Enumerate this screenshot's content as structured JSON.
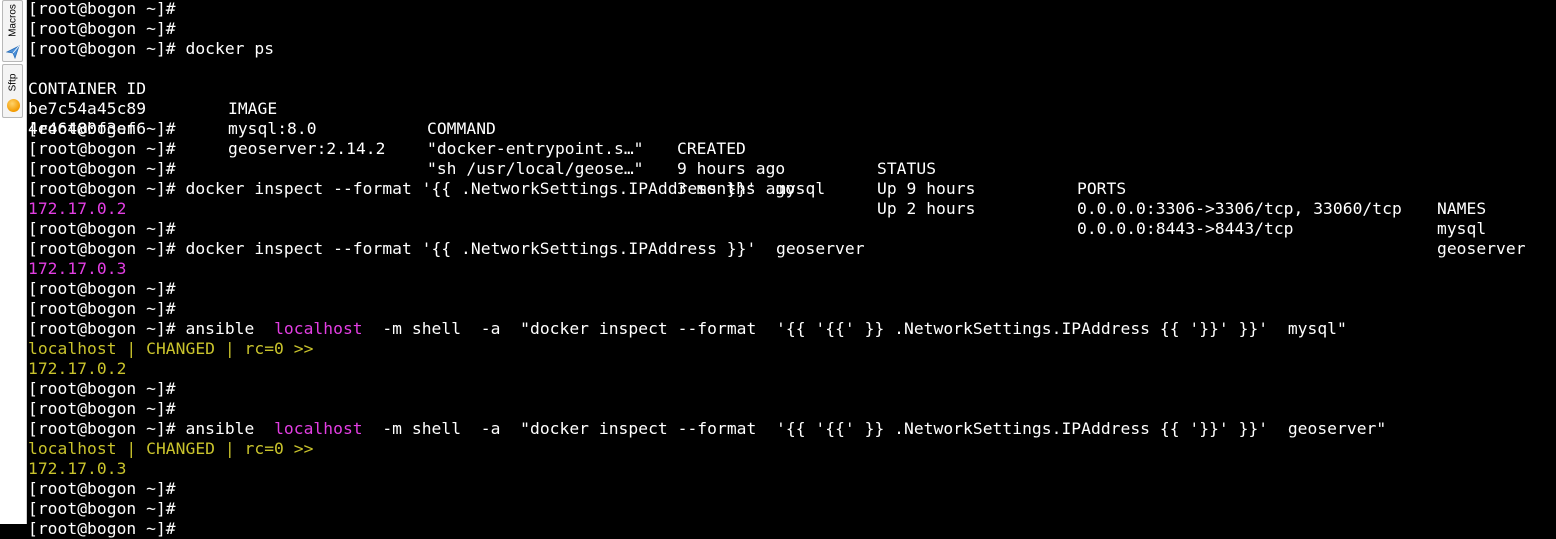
{
  "sidebar": {
    "tabs": [
      {
        "label": "Macros",
        "icon": "paper-plane-icon"
      },
      {
        "label": "Sftp",
        "icon": "sftp-orb-icon"
      }
    ]
  },
  "colors": {
    "background": "#000000",
    "text": "#ffffff",
    "ip_output": "#e23ee2",
    "ansible_output": "#c9c32c",
    "ansible_host": "#e23ee2"
  },
  "terminal": {
    "prompt": "[root@bogon ~]#",
    "lines": [
      "[root@bogon ~]#",
      "[root@bogon ~]#",
      "[root@bogon ~]# docker ps",
      "",
      "",
      "",
      "[root@bogon ~]#",
      "[root@bogon ~]#",
      "[root@bogon ~]#",
      "[root@bogon ~]# docker inspect --format '{{ .NetworkSettings.IPAddress }}'  mysql",
      "172.17.0.2",
      "[root@bogon ~]#",
      "[root@bogon ~]# docker inspect --format '{{ .NetworkSettings.IPAddress }}'  geoserver",
      "172.17.0.3",
      "[root@bogon ~]#",
      "[root@bogon ~]#",
      "",
      "localhost | CHANGED | rc=0 >>",
      "172.17.0.2",
      "[root@bogon ~]#",
      "[root@bogon ~]#",
      "",
      "localhost | CHANGED | rc=0 >>",
      "172.17.0.3",
      "[root@bogon ~]#",
      "[root@bogon ~]#",
      "[root@bogon ~]#"
    ],
    "ansible_cmds": [
      {
        "pre": "[root@bogon ~]# ansible  ",
        "host": "localhost",
        "post": "  -m shell  -a  \"docker inspect --format  '{{ '{{' }} .NetworkSettings.IPAddress {{ '}}' }}'  mysql\""
      },
      {
        "pre": "[root@bogon ~]# ansible  ",
        "host": "localhost",
        "post": "  -m shell  -a  \"docker inspect --format  '{{ '{{' }} .NetworkSettings.IPAddress {{ '}}' }}'  geoserver\""
      }
    ],
    "docker_ps": {
      "headers": [
        "CONTAINER ID",
        "IMAGE",
        "COMMAND",
        "CREATED",
        "STATUS",
        "PORTS",
        "NAMES"
      ],
      "rows": [
        [
          "be7c54a45c89",
          "mysql:8.0",
          "\"docker-entrypoint.s…\"",
          "9 hours ago",
          "Up 9 hours",
          "0.0.0.0:3306->3306/tcp, 33060/tcp",
          "mysql"
        ],
        [
          "4e46480f3ef6",
          "geoserver:2.14.2",
          "\"sh /usr/local/geose…\"",
          "3 months ago",
          "Up 2 hours",
          "0.0.0.0:8443->8443/tcp",
          "geoserver"
        ]
      ]
    }
  }
}
